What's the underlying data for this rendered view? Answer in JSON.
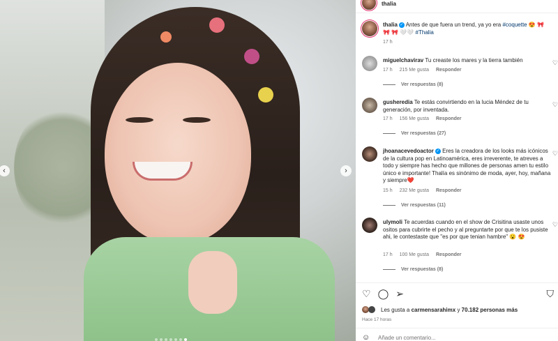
{
  "post": {
    "username": "thalia",
    "caption_text": "Antes de que fuera un trend, ya yo era",
    "caption_tag1": "#coquette",
    "caption_emojis1": "😍 🎀",
    "caption_emojis2": "🎀 🎀 🤍🤍",
    "caption_tag2": "#Thalia",
    "time": "17 h"
  },
  "comments": [
    {
      "username": "miguelchavirav",
      "text": "Tu creaste los mares y la tierra también",
      "time": "17 h",
      "likes": "215 Me gusta",
      "reply": "Responder",
      "view_replies": "Ver respuestas (8)"
    },
    {
      "username": "gusheredia",
      "text": "Te estás convirtiendo en la lucia Méndez de tu generación, por inventada.",
      "time": "17 h",
      "likes": "156 Me gusta",
      "reply": "Responder",
      "view_replies": "Ver respuestas (27)"
    },
    {
      "username": "jhoanacevedoactor",
      "text": "Eres la creadora de los looks más icónicos de la cultura pop en Latinoamérica, eres irreverente, te atreves a todo y siempre has hecho que millones de personas amen tu estilo único e importante! Thalía es sinónimo de moda, ayer, hoy, mañana y siempre❤️",
      "time": "15 h",
      "likes": "232 Me gusta",
      "reply": "Responder",
      "view_replies": "Ver respuestas (11)"
    },
    {
      "username": "ulymoli",
      "text": "Te acuerdas cuando en el show de Crisitina usaste unos ositos para cubrirte el pecho y al preguntarte por que te los pusiste ahi, le contestaste que \"es por que tenian hambre\" 😮 😍",
      "time": "17 h",
      "likes": "100 Me gusta",
      "reply": "Responder",
      "view_replies": "Ver respuestas (8)"
    }
  ],
  "liked_by": {
    "prefix": "Les gusta a",
    "user": "carmensarahimx",
    "connector": "y",
    "count": "70.182 personas más"
  },
  "posted_ago": "Hace 17 horas",
  "comment_placeholder": "Añade un comentario...",
  "icons": {
    "like": "heart-outline-icon",
    "comment": "comment-bubble-icon",
    "share": "paper-plane-icon",
    "save": "bookmark-icon",
    "emoji": "smiley-icon"
  },
  "colors": {
    "verified": "#0095f6",
    "hashtag": "#00376b",
    "secondary_text": "#737373"
  }
}
